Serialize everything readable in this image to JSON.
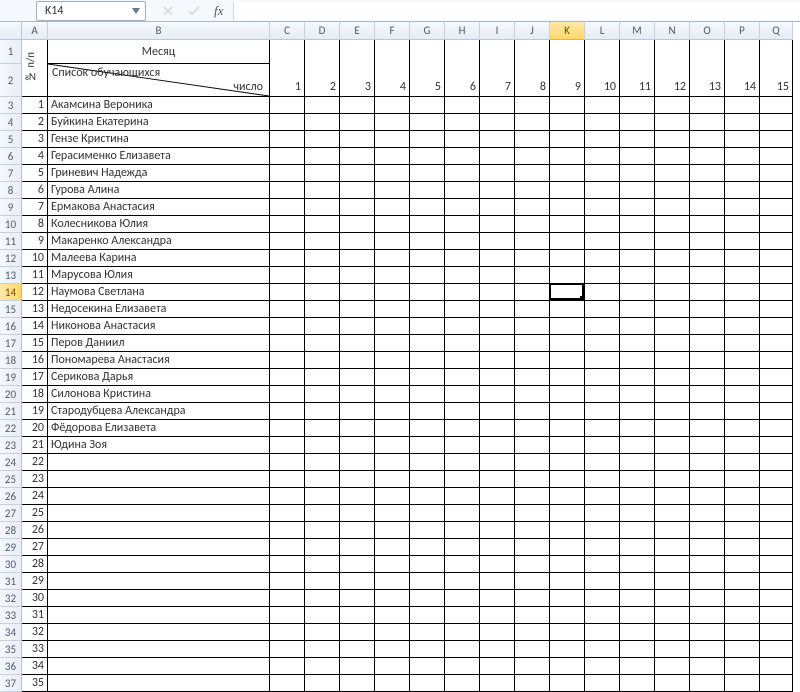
{
  "nameBox": "K14",
  "formula": "",
  "columns": [
    "A",
    "B",
    "C",
    "D",
    "E",
    "F",
    "G",
    "H",
    "I",
    "J",
    "K",
    "L",
    "M",
    "N",
    "O",
    "P",
    "Q"
  ],
  "colWidths": {
    "A": 26,
    "B": 222,
    "C": 35,
    "D": 35,
    "E": 35,
    "F": 35,
    "G": 35,
    "H": 35,
    "I": 35,
    "J": 35,
    "K": 35,
    "L": 35,
    "M": 35,
    "N": 35,
    "O": 35,
    "P": 35,
    "Q": 33
  },
  "row1": {
    "h": 24,
    "header_npp": "№ п/п",
    "month": "Месяц"
  },
  "row2": {
    "h": 33,
    "diag_top": "Список обучающихся",
    "diag_bot": "число",
    "days": [
      "1",
      "2",
      "3",
      "4",
      "5",
      "6",
      "7",
      "8",
      "9",
      "10",
      "11",
      "12",
      "13",
      "14",
      "15"
    ]
  },
  "dataRowH": 17,
  "students": [
    "Акамсина Вероника",
    "Буйкина Екатерина",
    "Гензе Кристина",
    "Герасименко Елизавета",
    "Гриневич Надежда",
    "Гурова Алина",
    "Ермакова Анастасия",
    "Колесникова Юлия",
    "Макаренко Александра",
    "Малеева Карина",
    "Марусова Юлия",
    "Наумова Светлана",
    "Недосекина Елизавета",
    "Никонова Анастасия",
    "Перов Даниил",
    "Пономарева Анастасия",
    "Серикова Дарья",
    "Силонова Кристина",
    "Стародубцева Александра",
    "Фёдорова Елизавета",
    "Юдина Зоя"
  ],
  "extraRows": [
    "22",
    "23",
    "24",
    "25",
    "26",
    "27",
    "28",
    "29",
    "30",
    "31",
    "32",
    "33",
    "34",
    "35"
  ],
  "selected": {
    "col": "K",
    "rowIndex": 14
  }
}
